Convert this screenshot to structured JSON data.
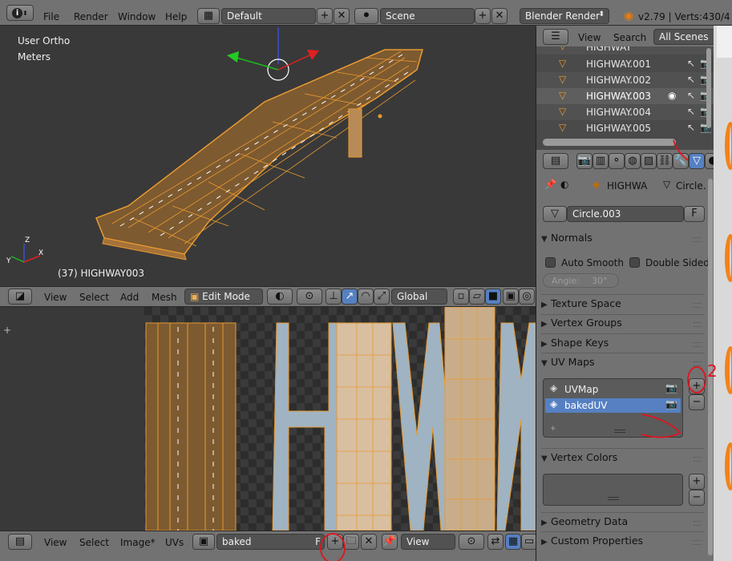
{
  "topbar": {
    "menus": [
      "File",
      "Render",
      "Window",
      "Help"
    ],
    "screen_layout": "Default",
    "scene": "Scene",
    "render_engine": "Blender Render",
    "version_stats": "v2.79 | Verts:430/4"
  },
  "viewport3d": {
    "view_label": "User Ortho",
    "units_label": "Meters",
    "object_label": "(37) HIGHWAY003",
    "header": {
      "menus": [
        "View",
        "Select",
        "Add",
        "Mesh"
      ],
      "mode": "Edit Mode",
      "orientation": "Global"
    }
  },
  "uv_editor": {
    "header": {
      "menus": [
        "View",
        "Select",
        "Image*",
        "UVs"
      ],
      "image_name": "baked",
      "view_dropdown": "View"
    }
  },
  "outliner": {
    "header": {
      "menus": [
        "View",
        "Search"
      ],
      "filter": "All Scenes"
    },
    "items": [
      {
        "name": "HIGHWAY",
        "selected": false,
        "visible": false,
        "partial": true
      },
      {
        "name": "HIGHWAY.001",
        "selected": false,
        "visible": false
      },
      {
        "name": "HIGHWAY.002",
        "selected": false,
        "visible": false
      },
      {
        "name": "HIGHWAY.003",
        "selected": true,
        "visible": true
      },
      {
        "name": "HIGHWAY.004",
        "selected": false,
        "visible": false
      },
      {
        "name": "HIGHWAY.005",
        "selected": false,
        "visible": false
      }
    ]
  },
  "properties": {
    "breadcrumb": {
      "object": "HIGHWA",
      "mesh": "Circle."
    },
    "mesh_name": "Circle.003",
    "fake_user": "F",
    "panels": {
      "normals": {
        "title": "Normals",
        "auto_smooth": "Auto Smooth",
        "double_sided": "Double Sided",
        "angle": "Angle:",
        "angle_value": "30°"
      },
      "texture_space": "Texture Space",
      "vertex_groups": "Vertex Groups",
      "shape_keys": "Shape Keys",
      "uv_maps": {
        "title": "UV Maps",
        "items": [
          {
            "name": "UVMap",
            "selected": false
          },
          {
            "name": "bakedUV",
            "selected": true
          }
        ]
      },
      "vertex_colors": "Vertex Colors",
      "geometry_data": "Geometry Data",
      "custom_properties": "Custom Properties"
    }
  },
  "annotations": {
    "number_label": "2",
    "color": "#e0141e"
  },
  "colors": {
    "selection_blue": "#5680c2",
    "mesh_orange": "#e89a30",
    "header_gray": "#727272"
  }
}
